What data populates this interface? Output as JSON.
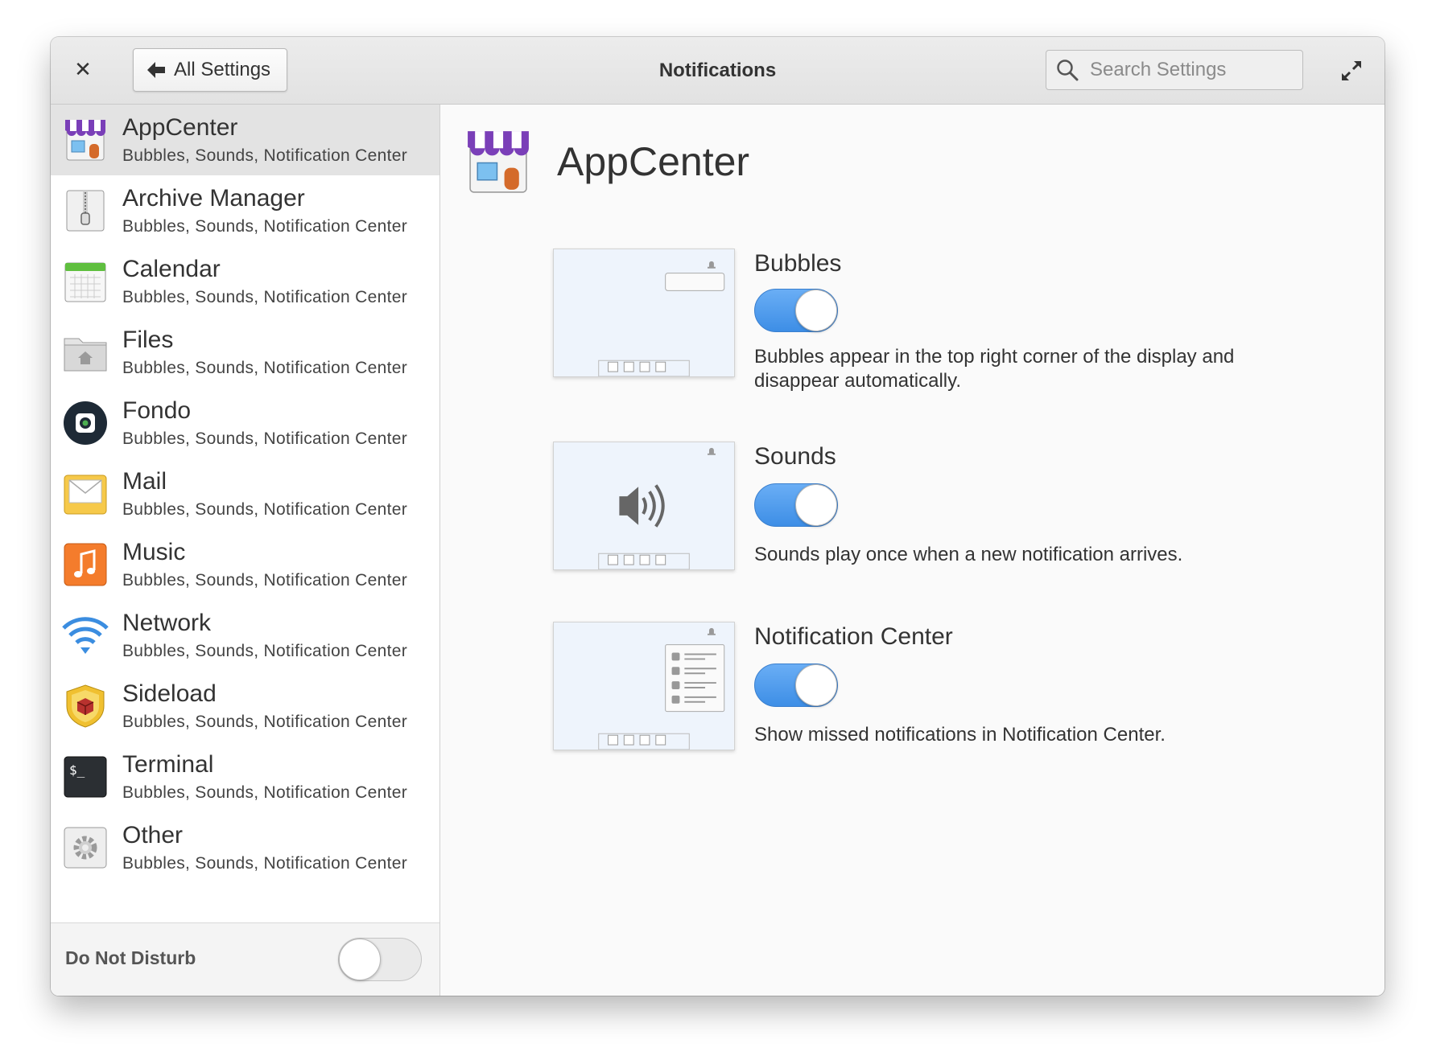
{
  "window": {
    "title": "Notifications",
    "back_label": "All Settings",
    "search_placeholder": "Search Settings"
  },
  "sidebar": {
    "items": [
      {
        "name": "AppCenter",
        "subtitle": "Bubbles, Sounds, Notification Center",
        "icon": "appcenter-icon",
        "selected": true
      },
      {
        "name": "Archive Manager",
        "subtitle": "Bubbles, Sounds, Notification Center",
        "icon": "archive-manager-icon"
      },
      {
        "name": "Calendar",
        "subtitle": "Bubbles, Sounds, Notification Center",
        "icon": "calendar-icon"
      },
      {
        "name": "Files",
        "subtitle": "Bubbles, Sounds, Notification Center",
        "icon": "files-icon"
      },
      {
        "name": "Fondo",
        "subtitle": "Bubbles, Sounds, Notification Center",
        "icon": "fondo-icon"
      },
      {
        "name": "Mail",
        "subtitle": "Bubbles, Sounds, Notification Center",
        "icon": "mail-icon"
      },
      {
        "name": "Music",
        "subtitle": "Bubbles, Sounds, Notification Center",
        "icon": "music-icon"
      },
      {
        "name": "Network",
        "subtitle": "Bubbles, Sounds, Notification Center",
        "icon": "network-icon"
      },
      {
        "name": "Sideload",
        "subtitle": "Bubbles, Sounds, Notification Center",
        "icon": "sideload-icon"
      },
      {
        "name": "Terminal",
        "subtitle": "Bubbles, Sounds, Notification Center",
        "icon": "terminal-icon"
      },
      {
        "name": "Other",
        "subtitle": "Bubbles, Sounds, Notification Center",
        "icon": "gear-icon"
      }
    ],
    "dnd_label": "Do Not Disturb",
    "dnd_on": false
  },
  "detail": {
    "app_name": "AppCenter",
    "settings": [
      {
        "title": "Bubbles",
        "on": true,
        "description": "Bubbles appear in the top right corner of the display and disappear automatically."
      },
      {
        "title": "Sounds",
        "on": true,
        "description": "Sounds play once when a new notification arrives."
      },
      {
        "title": "Notification Center",
        "on": true,
        "description": "Show missed notifications in Notification Center."
      }
    ]
  },
  "colors": {
    "accent": "#3d8ee6",
    "selected_row": "#e3e3e3"
  }
}
